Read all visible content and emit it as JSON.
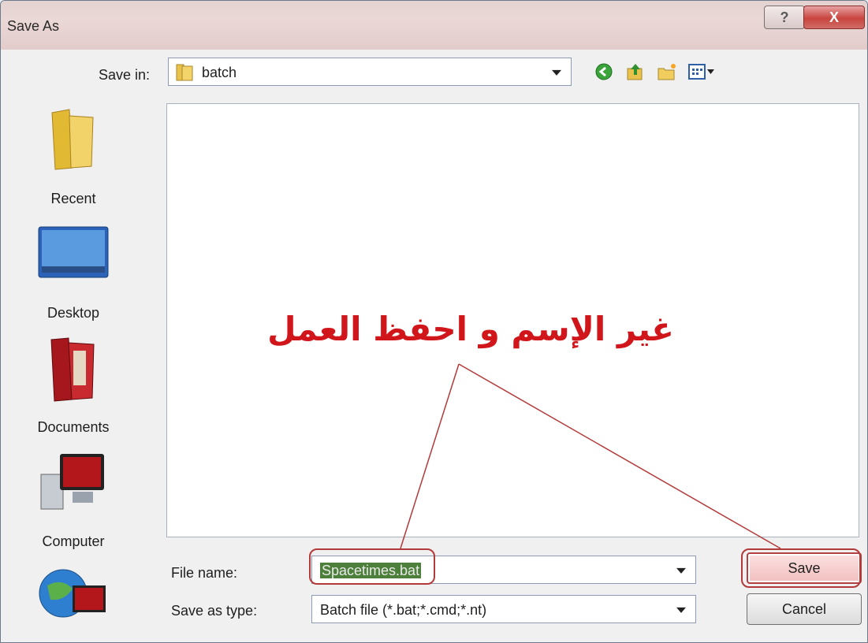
{
  "window": {
    "title": "Save As",
    "help_symbol": "?",
    "close_symbol": "X"
  },
  "toolbar": {
    "save_in_label": "Save in:",
    "current_folder": "batch",
    "icons": [
      "back-icon",
      "up-folder-icon",
      "new-folder-icon",
      "view-menu-icon"
    ]
  },
  "places": [
    {
      "label": "Recent",
      "icon": "recent-icon"
    },
    {
      "label": "Desktop",
      "icon": "desktop-icon"
    },
    {
      "label": "Documents",
      "icon": "documents-icon"
    },
    {
      "label": "Computer",
      "icon": "computer-icon"
    },
    {
      "label": "",
      "icon": "network-icon"
    }
  ],
  "annotation": {
    "text": "غير الإسم و احفظ العمل",
    "color": "#d1161b"
  },
  "form": {
    "file_name_label": "File name:",
    "file_name_value": "Spacetimes.bat",
    "save_as_type_label": "Save as type:",
    "save_as_type_value": "Batch file (*.bat;*.cmd;*.nt)"
  },
  "buttons": {
    "save": "Save",
    "cancel": "Cancel"
  },
  "colors": {
    "highlight": "#b33a3a",
    "selection": "#4b7f3a"
  }
}
